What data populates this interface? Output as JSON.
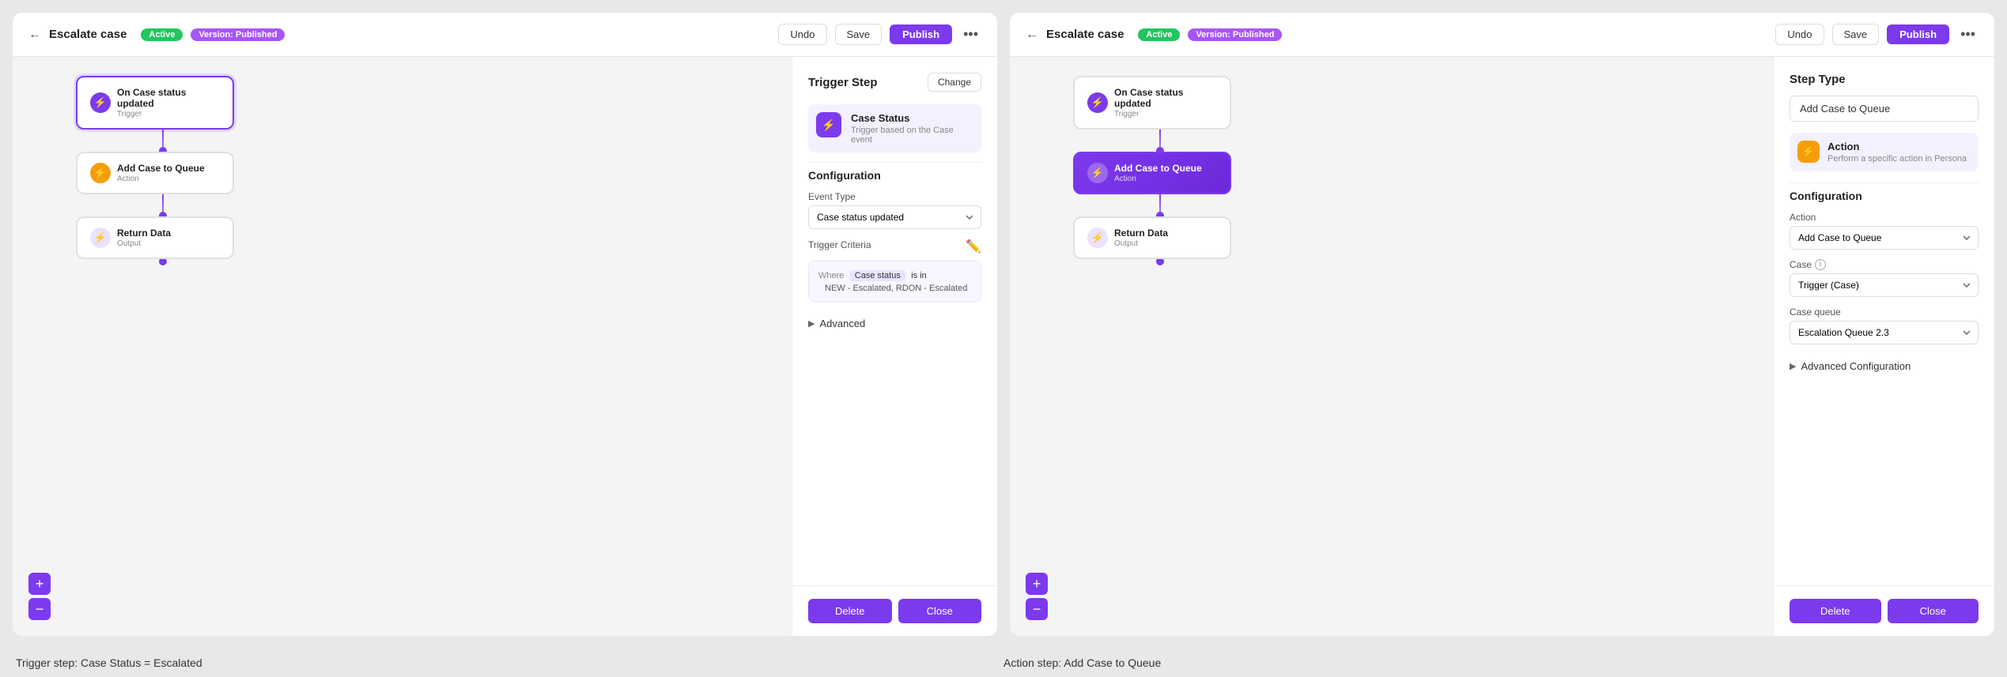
{
  "panels": [
    {
      "id": "left-panel",
      "header": {
        "back_label": "←",
        "title": "Escalate case",
        "badge_active": "Active",
        "badge_published": "Version: Published",
        "btn_undo": "Undo",
        "btn_save": "Save",
        "btn_publish": "Publish",
        "btn_dots": "•••"
      },
      "workflow": {
        "nodes": [
          {
            "id": "trigger",
            "title": "On Case status updated",
            "label": "Trigger",
            "icon": "⚡",
            "type": "trigger-active"
          },
          {
            "id": "action",
            "title": "Add Case to Queue",
            "label": "Action",
            "icon": "⚡",
            "type": "action"
          },
          {
            "id": "output",
            "title": "Return Data",
            "label": "Output",
            "icon": "⚡",
            "type": "output"
          }
        ]
      },
      "side_panel": {
        "title": "Trigger Step",
        "btn_change": "Change",
        "trigger_types": [
          {
            "icon": "⚡",
            "name": "Case Status",
            "desc": "Trigger based on the Case event",
            "selected": true
          }
        ],
        "configuration": {
          "title": "Configuration",
          "event_type_label": "Event Type",
          "event_type_value": "Case status updated",
          "trigger_criteria_label": "Trigger Criteria",
          "criteria": {
            "where_label": "Where",
            "field": "Case status",
            "operator": "is in",
            "value": "NEW - Escalated, RDON - Escalated"
          }
        },
        "advanced_label": "Advanced",
        "btn_delete": "Delete",
        "btn_close": "Close"
      }
    },
    {
      "id": "right-panel",
      "header": {
        "back_label": "←",
        "title": "Escalate case",
        "badge_active": "Active",
        "badge_published": "Version: Published",
        "btn_undo": "Undo",
        "btn_save": "Save",
        "btn_publish": "Publish",
        "btn_dots": "•••"
      },
      "workflow": {
        "nodes": [
          {
            "id": "trigger",
            "title": "On Case status updated",
            "label": "Trigger",
            "icon": "⚡",
            "type": "trigger"
          },
          {
            "id": "action",
            "title": "Add Case to Queue",
            "label": "Action",
            "icon": "⚡",
            "type": "action-active"
          },
          {
            "id": "output",
            "title": "Return Data",
            "label": "Output",
            "icon": "⚡",
            "type": "output"
          }
        ]
      },
      "config_panel": {
        "step_type_title": "Step Type",
        "step_type_value": "Add Case to Queue",
        "action_type": {
          "icon": "⚡",
          "name": "Action",
          "desc": "Perform a specific action in Persona"
        },
        "configuration": {
          "title": "Configuration",
          "action_label": "Action",
          "action_value": "Add Case to Queue",
          "case_label": "Case",
          "case_value": "Trigger (Case)",
          "queue_label": "Case queue",
          "queue_value": "Escalation Queue 2.3"
        },
        "advanced_label": "Advanced Configuration",
        "btn_delete": "Delete",
        "btn_close": "Close"
      }
    }
  ],
  "captions": {
    "left": "Trigger step: Case Status = Escalated",
    "right": "Action step: Add Case to Queue"
  }
}
